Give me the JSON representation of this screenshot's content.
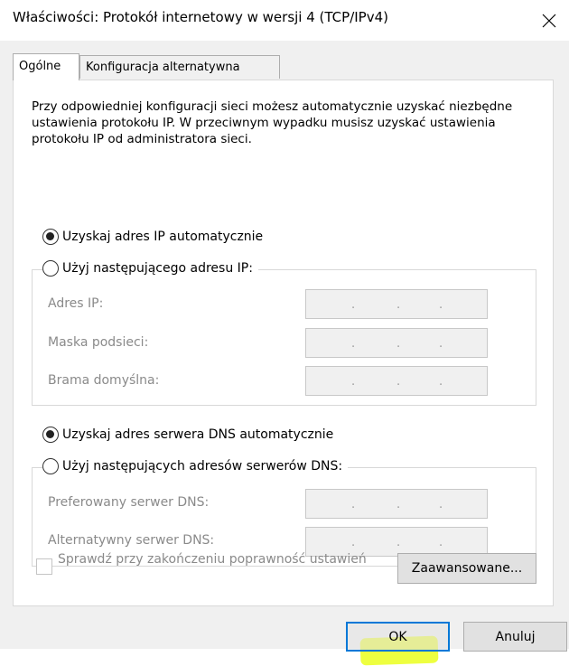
{
  "window": {
    "title": "Właściwości: Protokół internetowy w wersji 4 (TCP/IPv4)",
    "close_glyph": "✕"
  },
  "tabs": [
    {
      "label": "Ogólne",
      "active": true
    },
    {
      "label": "Konfiguracja alternatywna",
      "active": false
    }
  ],
  "intro": "Przy odpowiedniej konfiguracji sieci możesz automatycznie uzyskać niezbędne ustawienia protokołu IP. W przeciwnym wypadku musisz uzyskać ustawienia protokołu IP od administratora sieci.",
  "ip": {
    "auto_label": "Uzyskaj adres IP automatycznie",
    "manual_label": "Użyj następującego adresu IP:",
    "selected": "auto",
    "fields": [
      {
        "label": "Adres IP:",
        "value": ""
      },
      {
        "label": "Maska podsieci:",
        "value": ""
      },
      {
        "label": "Brama domyślna:",
        "value": ""
      }
    ]
  },
  "dns": {
    "auto_label": "Uzyskaj adres serwera DNS automatycznie",
    "manual_label": "Użyj następujących adresów serwerów DNS:",
    "selected": "auto",
    "fields": [
      {
        "label": "Preferowany serwer DNS:",
        "value": ""
      },
      {
        "label": "Alternatywny serwer DNS:",
        "value": ""
      }
    ]
  },
  "validate": {
    "label": "Sprawdź przy zakończeniu poprawność ustawień",
    "checked": false,
    "enabled": false
  },
  "buttons": {
    "advanced": "Zaawansowane...",
    "ok": "OK",
    "cancel": "Anuluj"
  },
  "colors": {
    "focus_border": "#0078d7",
    "highlight": "#e8ff00"
  }
}
